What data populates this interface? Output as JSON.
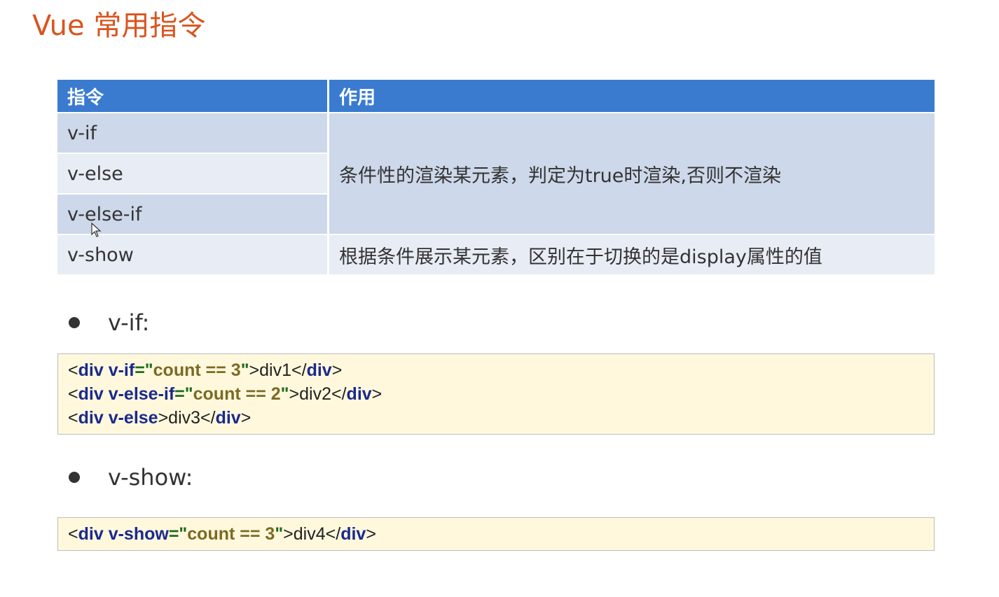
{
  "title": "Vue 常用指令",
  "table": {
    "headers": [
      "指令",
      "作用"
    ],
    "rows": [
      {
        "directive": "v-if"
      },
      {
        "directive": "v-else"
      },
      {
        "directive": "v-else-if"
      },
      {
        "directive": "v-show"
      }
    ],
    "desc_conditional": "条件性的渲染某元素，判定为true时渲染,否则不渲染",
    "desc_show": "根据条件展示某元素，区别在于切换的是display属性的值"
  },
  "sections": [
    {
      "heading": "v-if:",
      "code": [
        [
          {
            "t": "<"
          },
          {
            "t": "div",
            "c": "kw"
          },
          {
            "t": " "
          },
          {
            "t": "v-if",
            "c": "kw"
          },
          {
            "t": "=\"",
            "c": "str"
          },
          {
            "t": "count == 3",
            "c": "val"
          },
          {
            "t": "\"",
            "c": "str"
          },
          {
            "t": ">div1</"
          },
          {
            "t": "div",
            "c": "kw"
          },
          {
            "t": ">"
          }
        ],
        [
          {
            "t": "<"
          },
          {
            "t": "div",
            "c": "kw"
          },
          {
            "t": " "
          },
          {
            "t": "v-else-if",
            "c": "kw"
          },
          {
            "t": "=\"",
            "c": "str"
          },
          {
            "t": "count == 2",
            "c": "val"
          },
          {
            "t": "\"",
            "c": "str"
          },
          {
            "t": ">div2</"
          },
          {
            "t": "div",
            "c": "kw"
          },
          {
            "t": ">"
          }
        ],
        [
          {
            "t": "<"
          },
          {
            "t": "div",
            "c": "kw"
          },
          {
            "t": " "
          },
          {
            "t": "v-else",
            "c": "kw"
          },
          {
            "t": ">div3</"
          },
          {
            "t": "div",
            "c": "kw"
          },
          {
            "t": ">"
          }
        ]
      ]
    },
    {
      "heading": "v-show:",
      "code": [
        [
          {
            "t": "<"
          },
          {
            "t": "div",
            "c": "kw"
          },
          {
            "t": " "
          },
          {
            "t": "v-show",
            "c": "kw"
          },
          {
            "t": "=\"",
            "c": "str"
          },
          {
            "t": "count == 3",
            "c": "val"
          },
          {
            "t": "\"",
            "c": "str"
          },
          {
            "t": ">div4</"
          },
          {
            "t": "div",
            "c": "kw"
          },
          {
            "t": ">"
          }
        ]
      ]
    }
  ],
  "colors": {
    "title": "#d9541e",
    "header": "#3a7bd0",
    "code_bg": "#fff8dd"
  }
}
